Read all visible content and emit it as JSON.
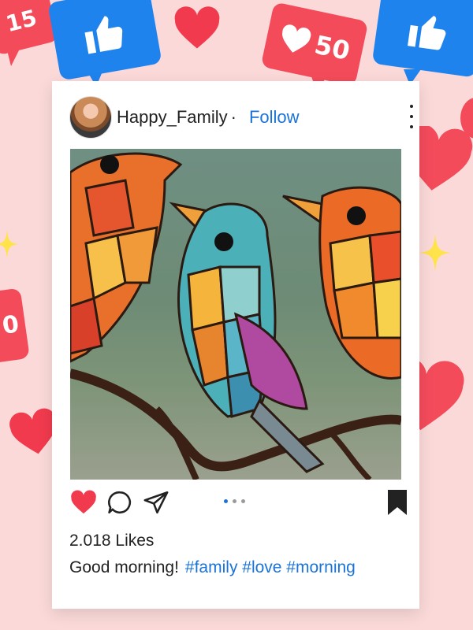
{
  "background_color": "#fbd9d9",
  "badges": {
    "likes_15": "15",
    "likes_50": "50",
    "left_partial": "0"
  },
  "post": {
    "username": "Happy_Family",
    "separator": "·",
    "follow_label": "Follow",
    "likes_text": "2.018 Likes",
    "caption": "Good morning!",
    "hashtags": "#family #love #morning",
    "liked": true,
    "carousel_pages": 3,
    "carousel_active": 1
  },
  "colors": {
    "like_red": "#f23a4e",
    "link_blue": "#1a73d9",
    "badge_red": "#f44b5b",
    "badge_blue": "#1f83ee"
  },
  "icons": [
    "heart-icon",
    "comment-icon",
    "share-icon",
    "bookmark-icon",
    "more-icon",
    "thumbs-up-icon"
  ]
}
